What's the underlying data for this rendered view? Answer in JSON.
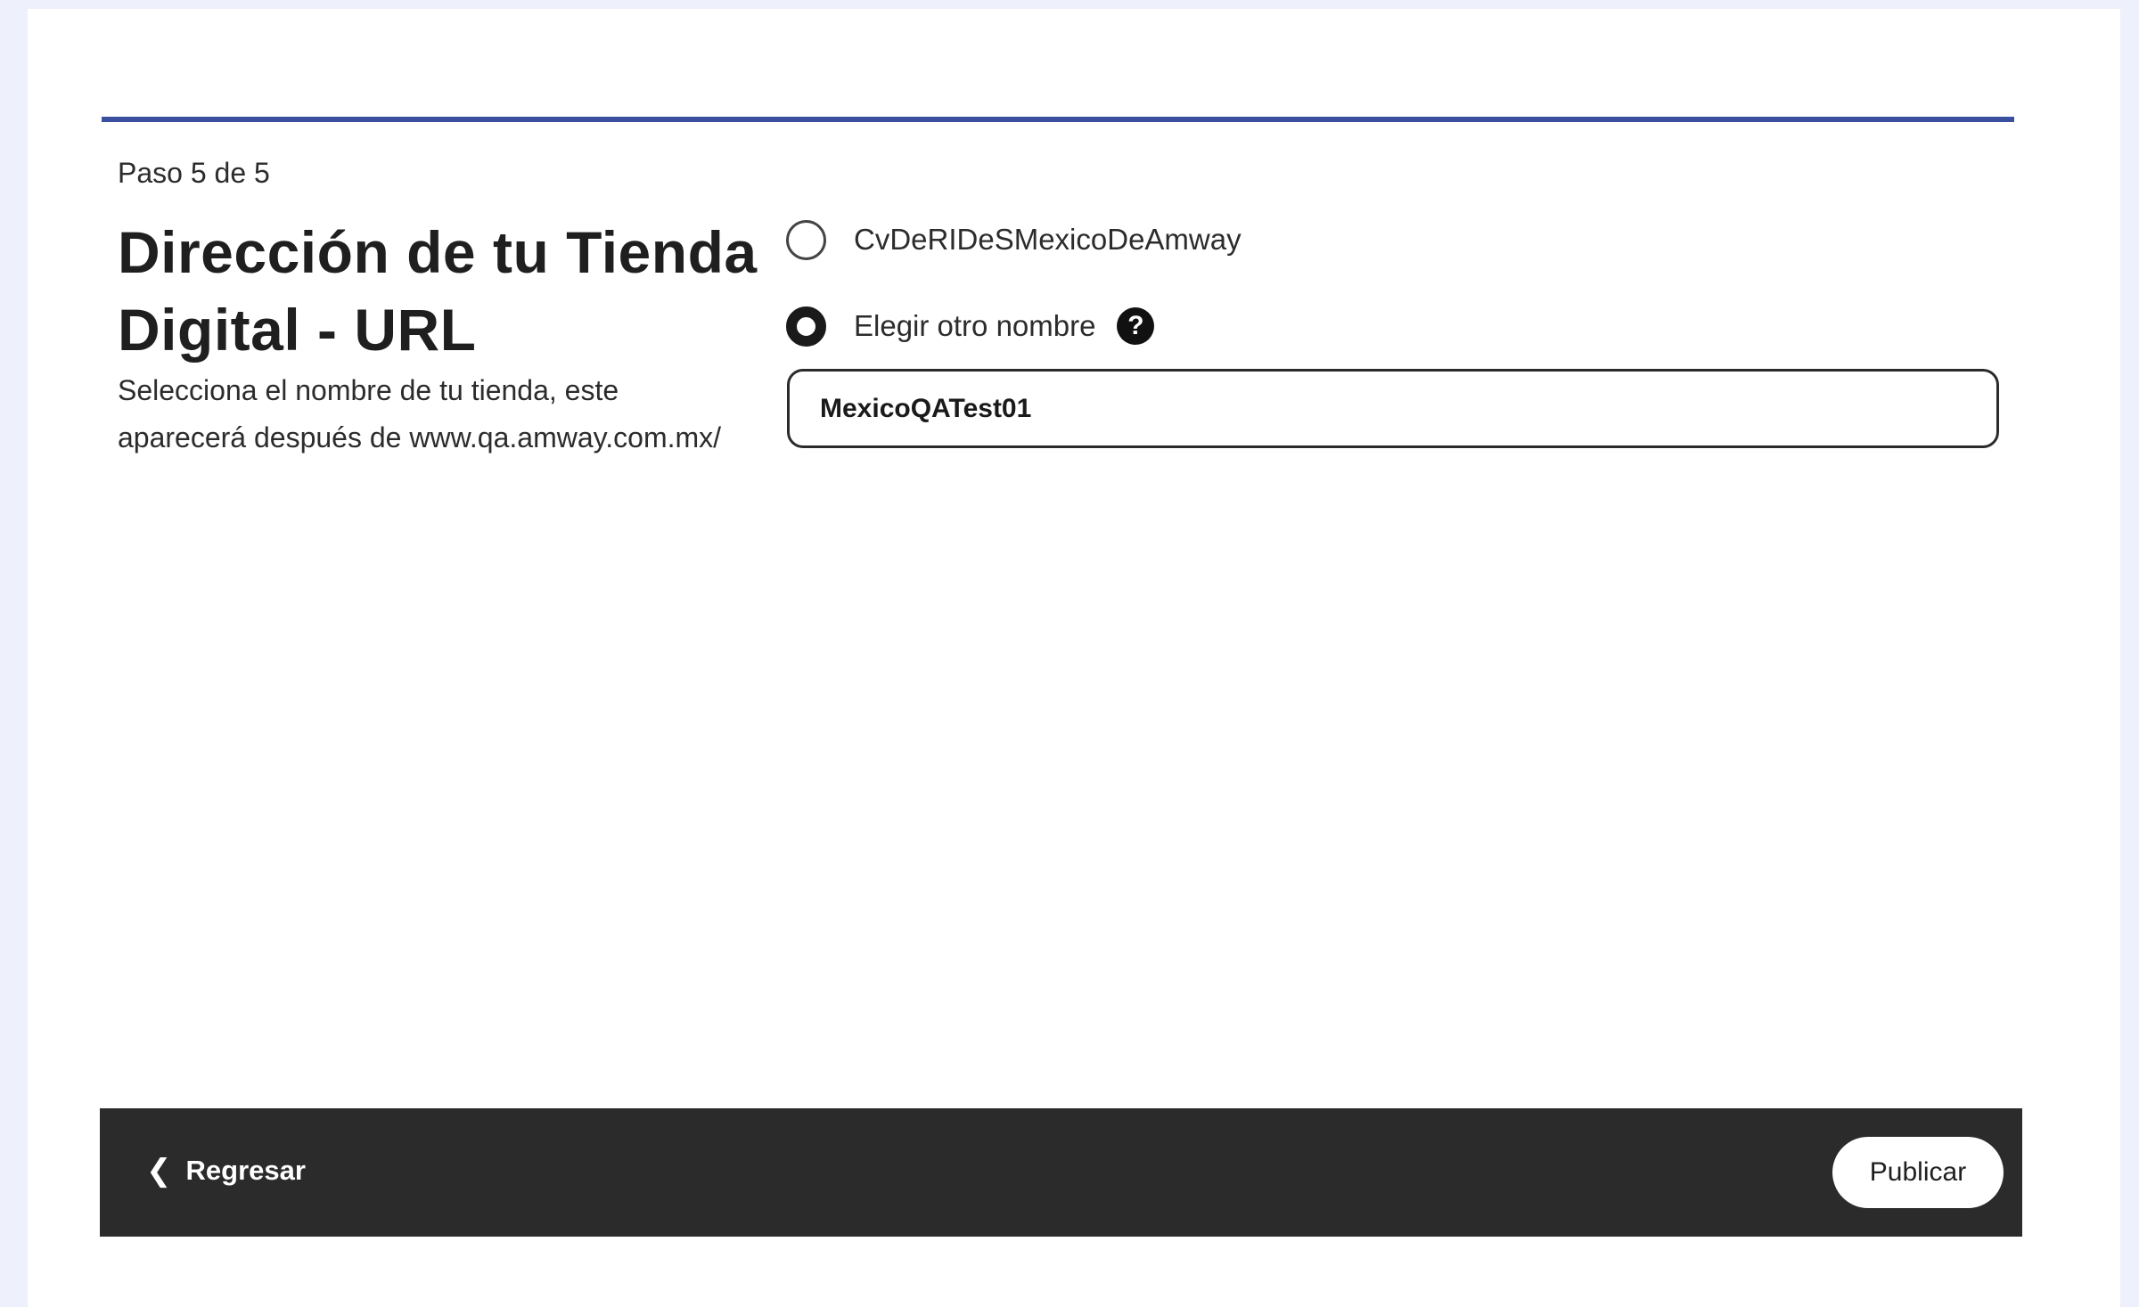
{
  "progress": {
    "step_current": 5,
    "step_total": 5,
    "fraction": 1.0,
    "color": "#3a4f9e"
  },
  "step_text": "Paso 5 de 5",
  "title": "Dirección de tu Tienda Digital - URL",
  "description": "Selecciona el nombre de tu tienda, este aparecerá después de www.qa.amway.com.mx/",
  "options": [
    {
      "label": "CvDeRIDeSMexicoDeAmway",
      "selected": false
    },
    {
      "label": "Elegir otro nombre",
      "selected": true
    }
  ],
  "help_icon": {
    "name": "question-circle-icon",
    "glyph": "?"
  },
  "custom_name": {
    "value": "MexicoQATest01"
  },
  "footer": {
    "back_chevron": "❮",
    "back_label": "Regresar",
    "publish_label": "Publicar",
    "background": "#2b2b2b"
  }
}
